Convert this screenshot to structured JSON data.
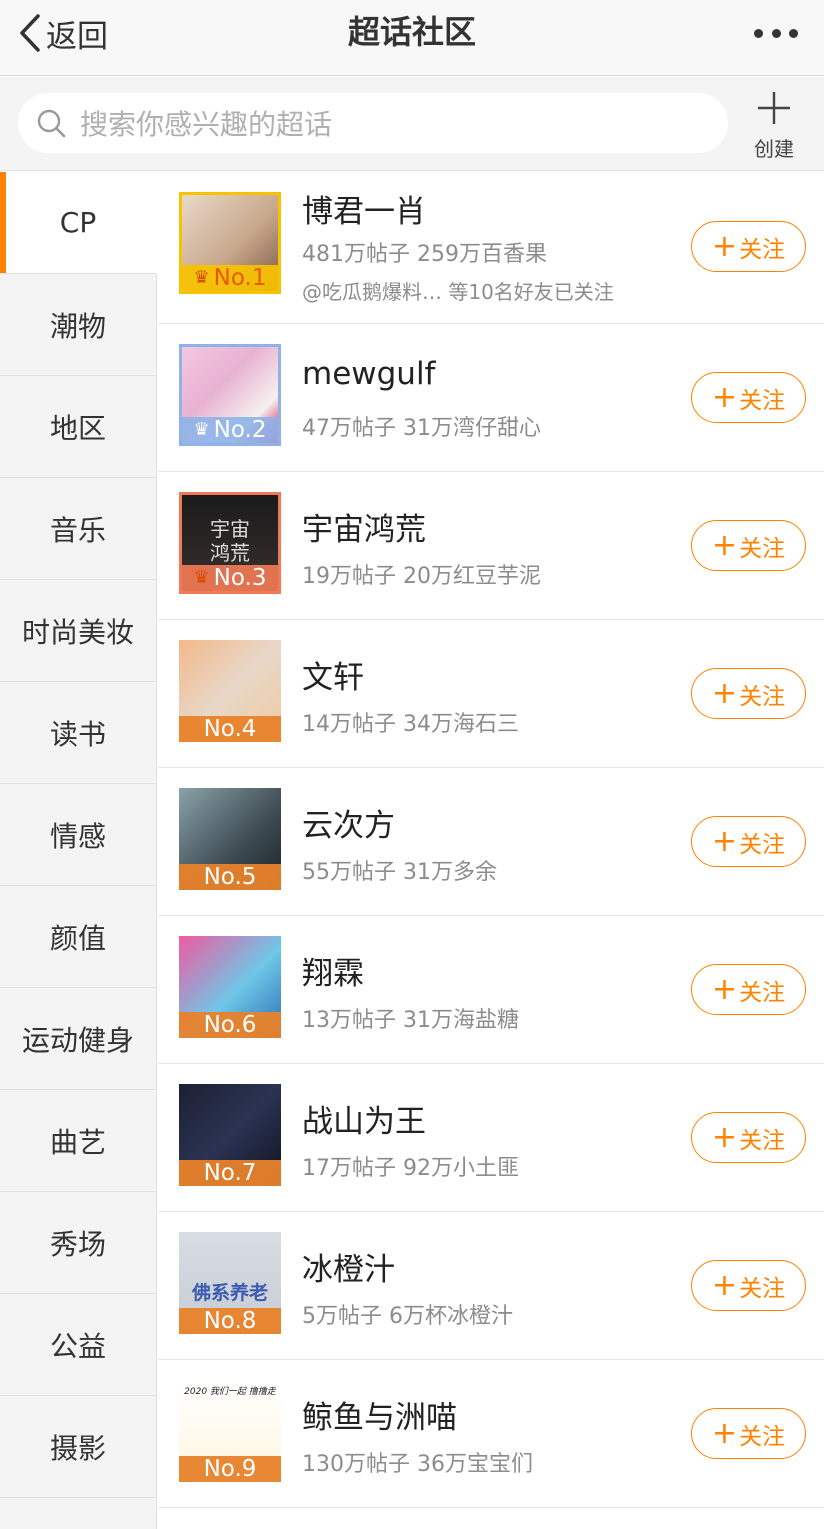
{
  "nav": {
    "back_label": "返回",
    "title": "超话社区"
  },
  "search": {
    "placeholder": "搜索你感兴趣的超话",
    "create_label": "创建"
  },
  "colors": {
    "accent": "#ff8200",
    "rank1": "#f7c200",
    "rank2": "#8fb3e8",
    "rank3": "#f07a55",
    "rank_other": "#e8822a"
  },
  "sidebar": {
    "items": [
      {
        "label": "CP",
        "active": true
      },
      {
        "label": "潮物"
      },
      {
        "label": "地区"
      },
      {
        "label": "音乐"
      },
      {
        "label": "时尚美妆"
      },
      {
        "label": "读书"
      },
      {
        "label": "情感"
      },
      {
        "label": "颜值"
      },
      {
        "label": "运动健身"
      },
      {
        "label": "曲艺"
      },
      {
        "label": "秀场"
      },
      {
        "label": "公益"
      },
      {
        "label": "摄影"
      }
    ]
  },
  "topics": [
    {
      "name": "博君一肖",
      "stats": "481万帖子 259万百香果",
      "friends": "@吃瓜鹅爆料…  等10名好友已关注",
      "rank": "No.1",
      "follow_label": "关注"
    },
    {
      "name": "mewgulf",
      "stats": "47万帖子 31万湾仔甜心",
      "rank": "No.2",
      "follow_label": "关注"
    },
    {
      "name": "宇宙鸿荒",
      "stats": "19万帖子 20万红豆芋泥",
      "rank": "No.3",
      "follow_label": "关注",
      "thumb_text": "宇宙\n鸿荒"
    },
    {
      "name": "文轩",
      "stats": "14万帖子 34万海石三",
      "rank": "No.4",
      "follow_label": "关注"
    },
    {
      "name": "云次方",
      "stats": "55万帖子 31万多余",
      "rank": "No.5",
      "follow_label": "关注"
    },
    {
      "name": "翔霖",
      "stats": "13万帖子 31万海盐糖",
      "rank": "No.6",
      "follow_label": "关注"
    },
    {
      "name": "战山为王",
      "stats": "17万帖子 92万小土匪",
      "rank": "No.7",
      "follow_label": "关注"
    },
    {
      "name": "冰橙汁",
      "stats": "5万帖子 6万杯冰橙汁",
      "rank": "No.8",
      "follow_label": "关注",
      "thumb_text": "佛系养老"
    },
    {
      "name": "鲸鱼与洲喵",
      "stats": "130万帖子 36万宝宝们",
      "rank": "No.9",
      "follow_label": "关注",
      "thumb_text": "2020 我们一起 撸撸走"
    }
  ]
}
